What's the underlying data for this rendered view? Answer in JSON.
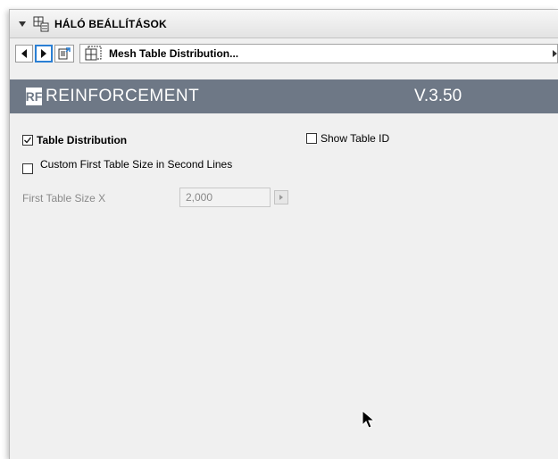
{
  "header": {
    "title": "HÁLÓ BEÁLLÍTÁSOK",
    "icon": "mesh-settings-icon"
  },
  "nav": {
    "selector_label": "Mesh Table Distribution..."
  },
  "banner": {
    "brand": "REINFORCEMENT",
    "logo_text": "RF",
    "version": "V.3.50",
    "color": "#6e7886"
  },
  "options": {
    "table_distribution": {
      "label": "Table Distribution",
      "checked": true
    },
    "show_table_id": {
      "label": "Show Table ID",
      "checked": false
    },
    "custom_first_table": {
      "label": "Custom First Table Size in Second Lines",
      "checked": false
    }
  },
  "first_table_size_x": {
    "label": "First Table Size X",
    "value": "2,000"
  }
}
